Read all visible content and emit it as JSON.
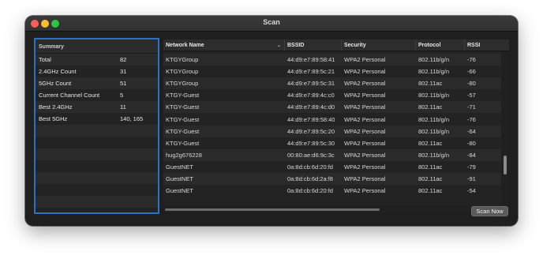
{
  "window": {
    "title": "Scan"
  },
  "summary": {
    "header": "Summary",
    "rows": [
      {
        "label": "Total",
        "value": "82"
      },
      {
        "label": "2.4GHz Count",
        "value": "31"
      },
      {
        "label": "5GHz Count",
        "value": "51"
      },
      {
        "label": "Current Channel Count",
        "value": "5"
      },
      {
        "label": "Best 2.4GHz",
        "value": "11"
      },
      {
        "label": "Best 5GHz",
        "value": "140, 165"
      }
    ]
  },
  "table": {
    "columns": [
      "Network Name",
      "BSSID",
      "Security",
      "Protocol",
      "RSSI"
    ],
    "rows": [
      [
        "KTGYGroup",
        "44:d9:e7:89:58:41",
        "WPA2 Personal",
        "802.11b/g/n",
        "-76"
      ],
      [
        "KTGYGroup",
        "44:d9:e7:89:5c:21",
        "WPA2 Personal",
        "802.11b/g/n",
        "-66"
      ],
      [
        "KTGYGroup",
        "44:d9:e7:89:5c:31",
        "WPA2 Personal",
        "802.11ac",
        "-80"
      ],
      [
        "KTGY-Guest",
        "44:d9:e7:89:4c:c0",
        "WPA2 Personal",
        "802.11b/g/n",
        "-57"
      ],
      [
        "KTGY-Guest",
        "44:d9:e7:89:4c:d0",
        "WPA2 Personal",
        "802.11ac",
        "-71"
      ],
      [
        "KTGY-Guest",
        "44:d9:e7:89:58:40",
        "WPA2 Personal",
        "802.11b/g/n",
        "-76"
      ],
      [
        "KTGY-Guest",
        "44:d9:e7:89:5c:20",
        "WPA2 Personal",
        "802.11b/g/n",
        "-64"
      ],
      [
        "KTGY-Guest",
        "44:d9:e7:89:5c:30",
        "WPA2 Personal",
        "802.11ac",
        "-80"
      ],
      [
        "hug2g676228",
        "00:80:ae:d6:9c:3c",
        "WPA2 Personal",
        "802.11b/g/n",
        "-84"
      ],
      [
        "GuestNET",
        "0a:8d:cb:6d:20:fd",
        "WPA2 Personal",
        "802.11ac",
        "-79"
      ],
      [
        "GuestNET",
        "0a:8d:cb:6d:2a:f8",
        "WPA2 Personal",
        "802.11ac",
        "-91"
      ],
      [
        "GuestNET",
        "0a:8d:cb:6d:20:fd",
        "WPA2 Personal",
        "802.11ac",
        "-54"
      ]
    ]
  },
  "actions": {
    "scan_now": "Scan Now"
  }
}
